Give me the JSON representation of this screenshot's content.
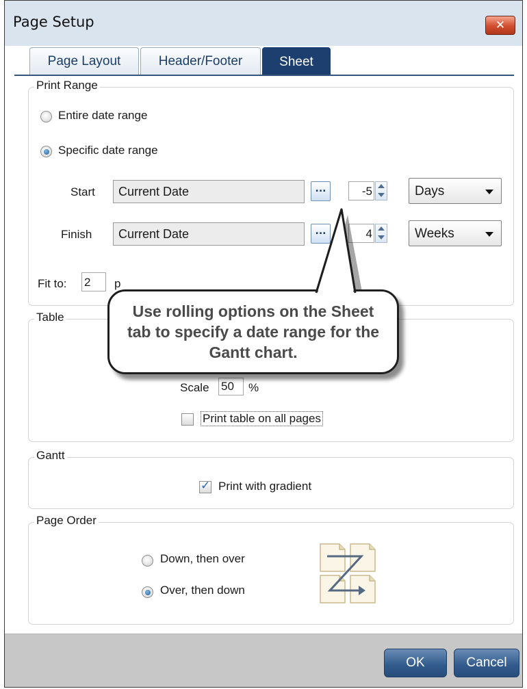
{
  "window": {
    "title": "Page Setup",
    "close_icon": "close-icon"
  },
  "tabs": [
    {
      "label": "Page Layout",
      "active": false
    },
    {
      "label": "Header/Footer",
      "active": false
    },
    {
      "label": "Sheet",
      "active": true
    }
  ],
  "print_range": {
    "group_label": "Print Range",
    "entire_label": "Entire date range",
    "entire_selected": false,
    "specific_label": "Specific date range",
    "specific_selected": true,
    "start": {
      "label": "Start",
      "value": "Current Date",
      "button": "...",
      "offset": "-5",
      "unit": "Days"
    },
    "finish": {
      "label": "Finish",
      "value": "Current Date",
      "button": "...",
      "offset": "4",
      "unit": "Weeks"
    },
    "fit_to_label": "Fit to:",
    "fit_to_value": "2",
    "fit_to_suffix_visible": "p"
  },
  "table": {
    "group_label": "Table",
    "scale_label": "Scale",
    "scale_value": "50",
    "scale_unit": "%",
    "print_all_label": "Print table on all pages",
    "print_all_checked": false
  },
  "gantt": {
    "group_label": "Gantt",
    "gradient_label": "Print with gradient",
    "gradient_checked": true
  },
  "page_order": {
    "group_label": "Page Order",
    "down_label": "Down, then over",
    "down_selected": false,
    "over_label": "Over, then down",
    "over_selected": true,
    "preview_icon": "page-order-z-icon"
  },
  "callout": {
    "text": "Use rolling options on the Sheet tab to specify a date range for the Gantt chart."
  },
  "footer": {
    "ok_label": "OK",
    "cancel_label": "Cancel"
  },
  "colors": {
    "titlebar": "#d9e4ef",
    "active_tab": "#1c3f70",
    "close_button": "#d24d2f",
    "footer": "#c7c7c7",
    "button": "#315a8c"
  }
}
